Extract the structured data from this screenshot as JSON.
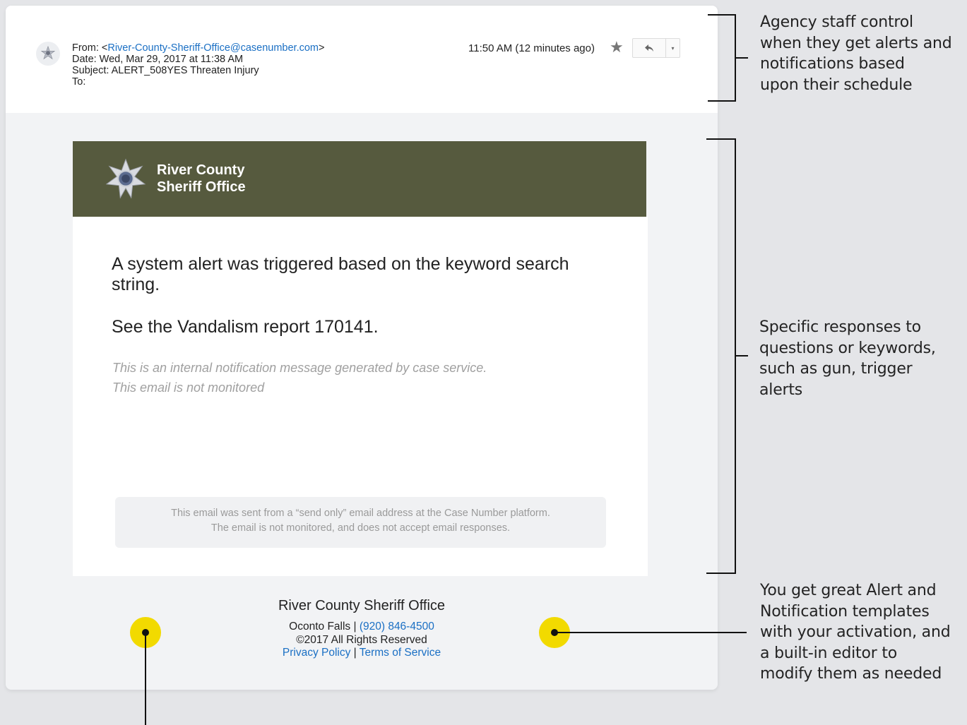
{
  "email": {
    "from_prefix": "From: <",
    "from_address": "River-County-Sheriff-Office@casenumber.com",
    "from_suffix": ">",
    "date": "Date: Wed, Mar 29, 2017 at 11:38 AM",
    "subject": "Subject: ALERT_508YES Threaten Injury",
    "to": "To:",
    "time": "11:50 AM (12 minutes ago)",
    "star_icon": "star-icon",
    "reply_icon": "reply-icon",
    "more_icon": "dropdown-arrow-icon"
  },
  "banner": {
    "line1": "River County",
    "line2": "Sheriff Office",
    "background": "#565a3e",
    "badge_icon": "sheriff-star-badge"
  },
  "body": {
    "message1": "A system alert was triggered based on the keyword search string.",
    "message2": "See the Vandalism report 170141.",
    "note1": "This is an internal notification message generated by case service.",
    "note2": "This email is not monitored",
    "disclaimer1": "This email was sent from a “send only” email address at the Case Number platform.",
    "disclaimer2": "The email is not monitored, and does not accept email responses."
  },
  "footer": {
    "org": "River County Sheriff Office",
    "location": "Oconto Falls | ",
    "phone": "(920) 846-4500",
    "copyright": "©2017 All Rights Reserved",
    "privacy": "Privacy Policy",
    "separator": " | ",
    "terms": "Terms of Service"
  },
  "annotations": {
    "top": [
      "Agency staff control",
      "when they get alerts and",
      "notifications based",
      "upon their schedule"
    ],
    "middle": [
      "Specific responses to",
      "questions or keywords,",
      "such as gun, trigger",
      "alerts"
    ],
    "bottom": [
      "You get great Alert and",
      "Notification templates",
      "with your activation, and",
      "a built-in editor to",
      "modify them as needed"
    ]
  },
  "colors": {
    "accent_yellow": "#f2da00",
    "link_blue": "#1a6fc4"
  }
}
